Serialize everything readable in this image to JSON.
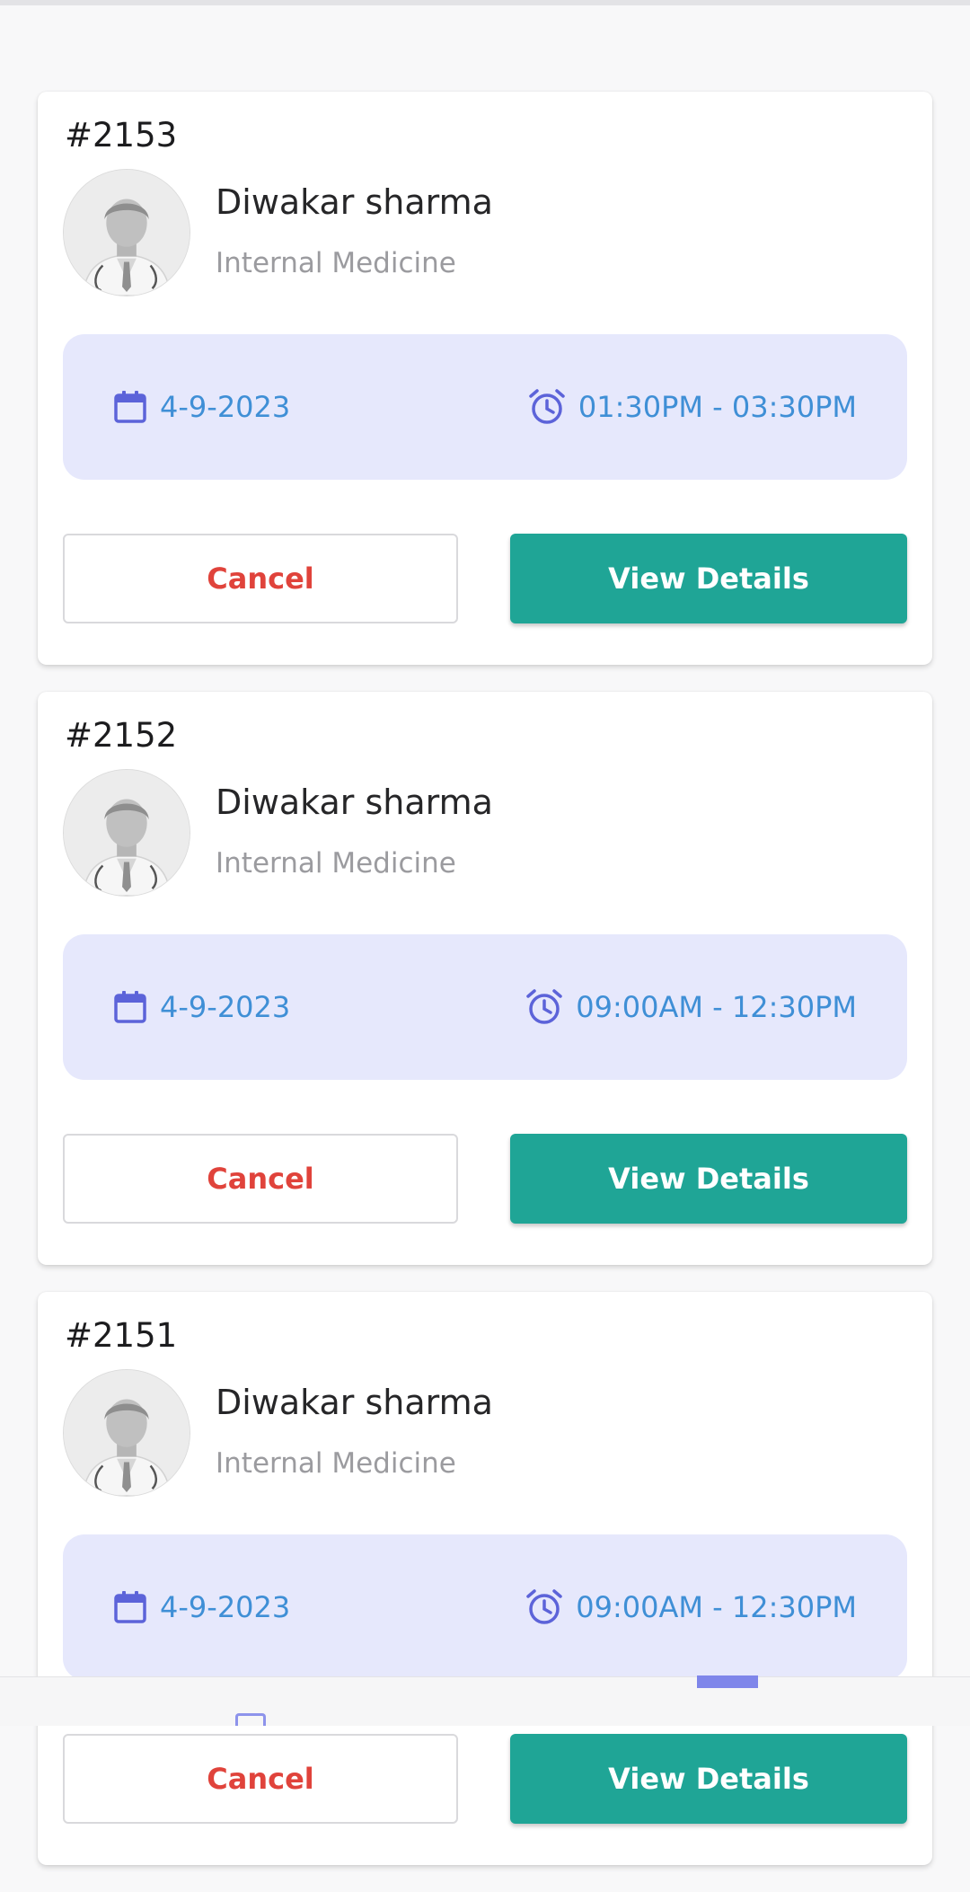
{
  "appointments": [
    {
      "id": "#2153",
      "doctor_name": "Diwakar sharma",
      "specialty": "Internal Medicine",
      "date": "4-9-2023",
      "time": "01:30PM - 03:30PM",
      "cancel_label": "Cancel",
      "details_label": "View Details"
    },
    {
      "id": "#2152",
      "doctor_name": "Diwakar sharma",
      "specialty": "Internal Medicine",
      "date": "4-9-2023",
      "time": "09:00AM - 12:30PM",
      "cancel_label": "Cancel",
      "details_label": "View Details"
    },
    {
      "id": "#2151",
      "doctor_name": "Diwakar sharma",
      "specialty": "Internal Medicine",
      "date": "4-9-2023",
      "time": "09:00AM - 12:30PM",
      "cancel_label": "Cancel",
      "details_label": "View Details"
    }
  ],
  "icons": {
    "date": "calendar-icon",
    "time": "alarm-clock-icon",
    "avatar": "doctor-avatar"
  },
  "colors": {
    "primary_button": "#1fa596",
    "cancel_text": "#e0433b",
    "schedule_bg": "#e6e8fc",
    "schedule_text": "#3f8fd6",
    "icon_accent": "#5c63d9",
    "nav_accent": "#7f86ea"
  }
}
